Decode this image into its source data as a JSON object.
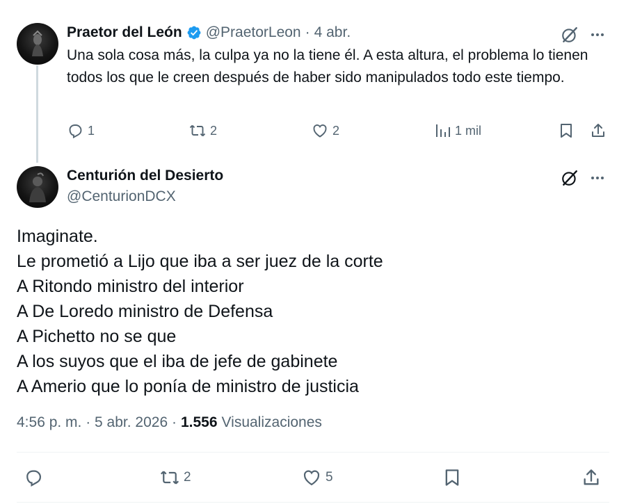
{
  "reply_tweet": {
    "display_name": "Praetor del León",
    "handle": "@PraetorLeon",
    "separator": "·",
    "date": "4 abr.",
    "text": "Una sola cosa más, la culpa ya no la tiene él. A esta altura, el problema lo tienen todos los que le creen después de haber sido manipulados todo este tiempo.",
    "replies": "1",
    "reposts": "2",
    "likes": "2",
    "views": "1 mil"
  },
  "main_tweet": {
    "display_name": "Centurión del Desierto",
    "handle": "@CenturionDCX",
    "lines": [
      "Imaginate.",
      "Le prometió a Lijo que iba a ser juez de la corte",
      "A Ritondo ministro del interior",
      "A De Loredo ministro de Defensa",
      "A Pichetto no se que",
      "A los suyos que el iba de jefe de gabinete",
      "A Amerio que lo ponía de ministro de justicia"
    ],
    "timestamp": "4:56 p. m. · 5 abr. 2026 ·",
    "views_count": "1.556",
    "views_label": "Visualizaciones",
    "reposts": "2",
    "likes": "5"
  },
  "icons": {
    "verified": "verified-badge-icon",
    "grok": "grok-icon",
    "more": "more-icon",
    "reply": "reply-icon",
    "repost": "repost-icon",
    "like": "heart-icon",
    "views": "analytics-icon",
    "bookmark": "bookmark-icon",
    "share": "share-icon"
  },
  "colors": {
    "text": "#0f1419",
    "secondary": "#536471",
    "verified": "#1d9bf0",
    "divider": "#eff3f4",
    "thread_line": "#cfd9de"
  }
}
